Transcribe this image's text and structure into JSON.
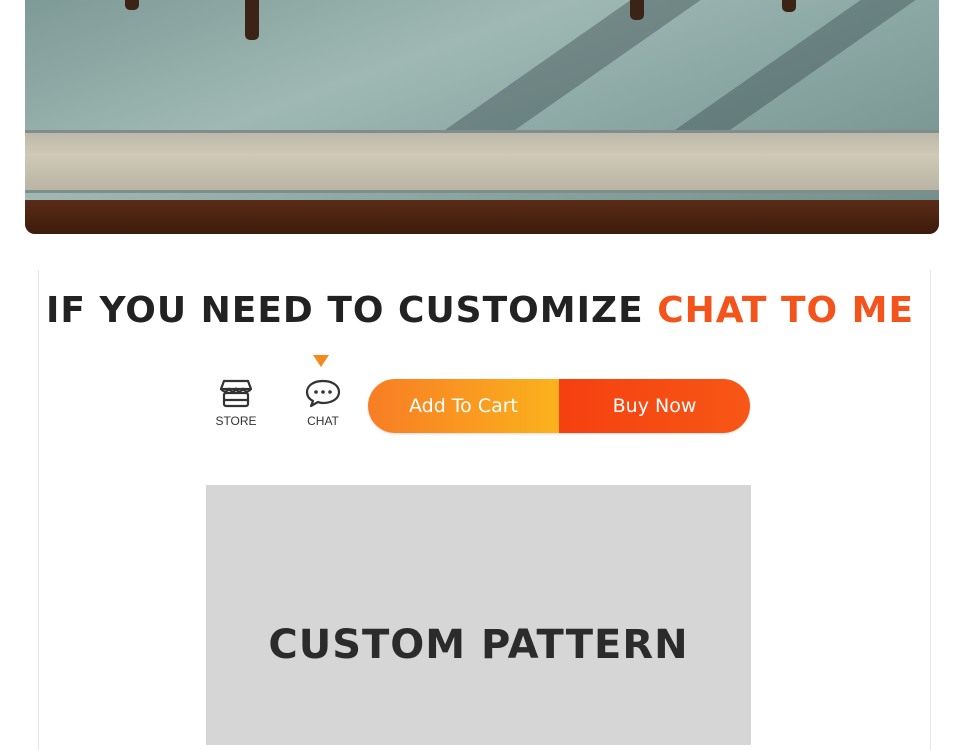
{
  "headline": {
    "prefix": "IF YOU NEED TO CUSTOMIZE",
    "accent": "CHAT TO ME",
    "accent_color": "#f2541b"
  },
  "icons": {
    "store": {
      "label": "STORE",
      "icon": "store-icon"
    },
    "chat": {
      "label": "CHAT",
      "icon": "chat-bubble-icon"
    }
  },
  "actions": {
    "add_to_cart": "Add To Cart",
    "buy_now": "Buy Now"
  },
  "pattern": {
    "label": "CUSTOM PATTERN"
  },
  "colors": {
    "pointer": "#f28a1c",
    "cart_gradient": [
      "#f87d24",
      "#fbb21d"
    ],
    "buy_gradient": [
      "#f5400f",
      "#f75716"
    ]
  }
}
